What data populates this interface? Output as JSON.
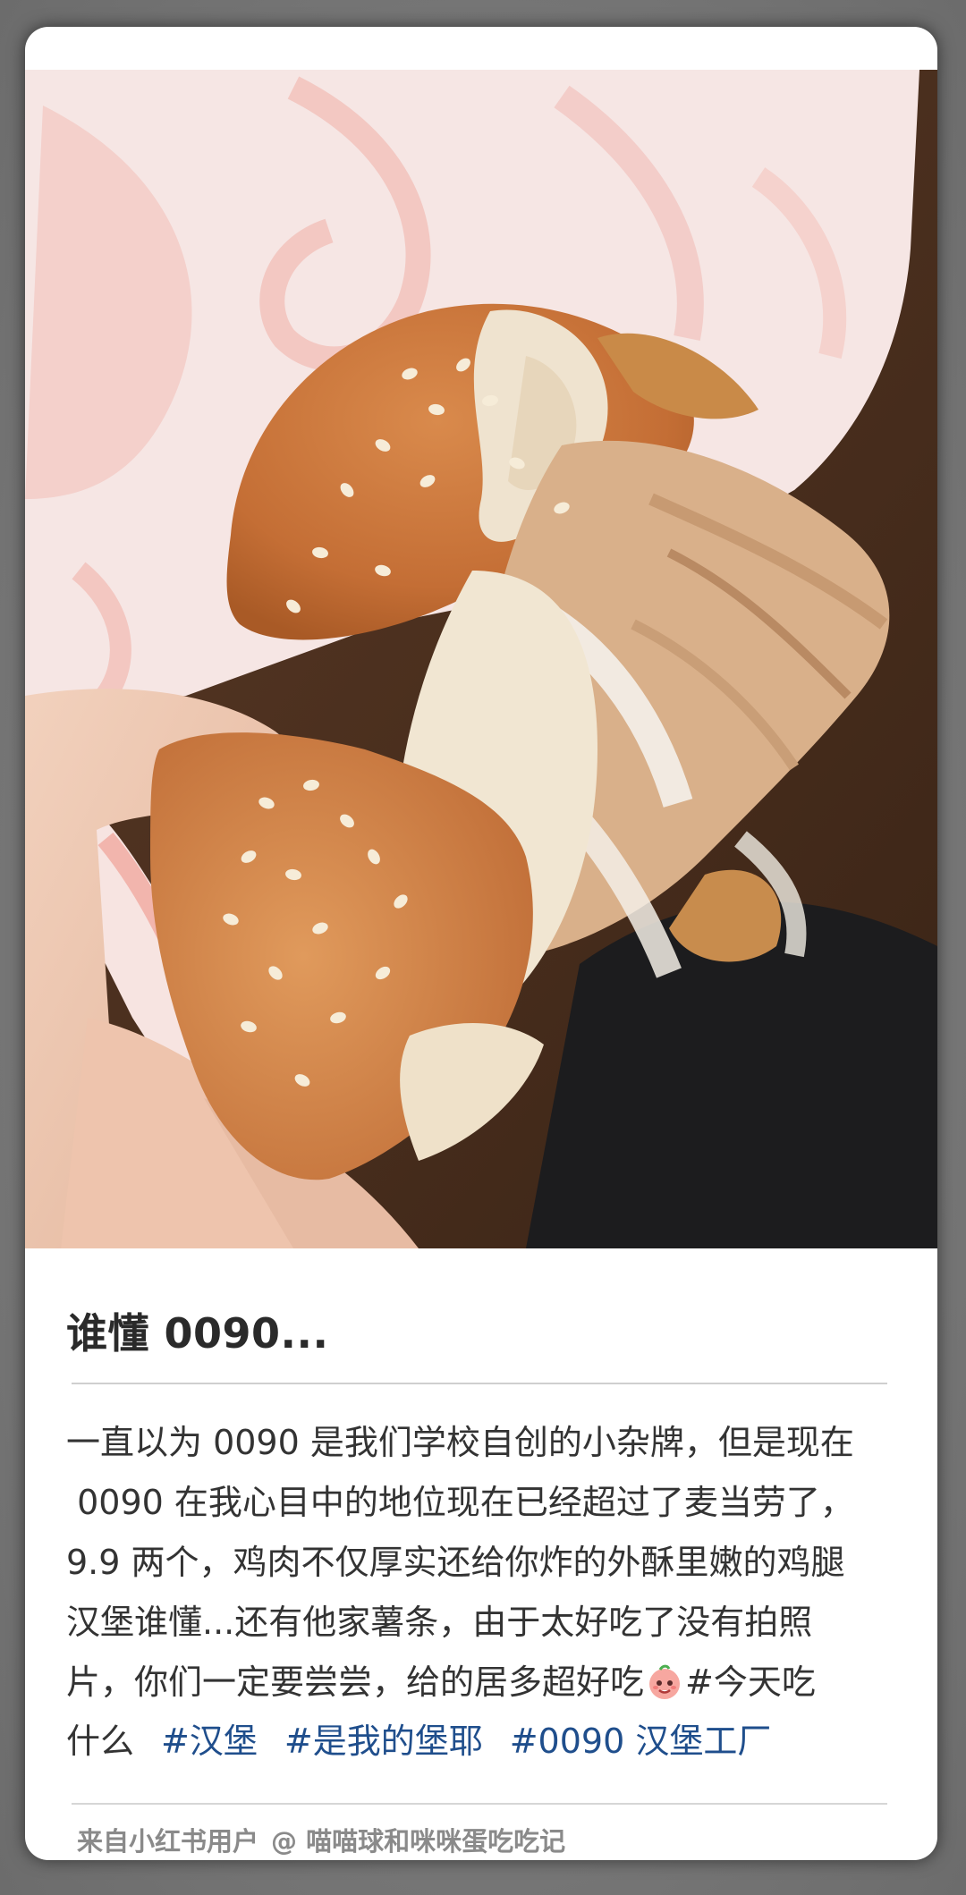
{
  "post": {
    "title": "谁懂 0090...",
    "body_lines": [
      "一直以为 0090 是我们学校自创的小杂牌，但是现在",
      " 0090 在我心目中的地位现在已经超过了麦当劳了，",
      "9.9 两个，鸡肉不仅厚实还给你炸的外酥里嫩的鸡腿",
      "汉堡谁懂...还有他家薯条，由于太好吃了没有拍照"
    ],
    "line5_before_emoji": "片，你们一定要尝尝，给的居多超好吃",
    "line5_after_emoji": "#今天吃",
    "line6_text": "什么",
    "tags": [
      "#汉堡",
      "#是我的堡耶",
      "#0090 汉堡工厂"
    ],
    "emoji_name": "peach-face-emoji",
    "photo_icon": "burger-photo"
  },
  "footer": {
    "source": "来自小红书用户",
    "handle": "@ 喵喵球和咪咪蛋吃吃记"
  },
  "colors": {
    "tag": "#1f4e8c",
    "text": "#333333",
    "footer": "#8a8a8a",
    "background": "#ffffff"
  }
}
